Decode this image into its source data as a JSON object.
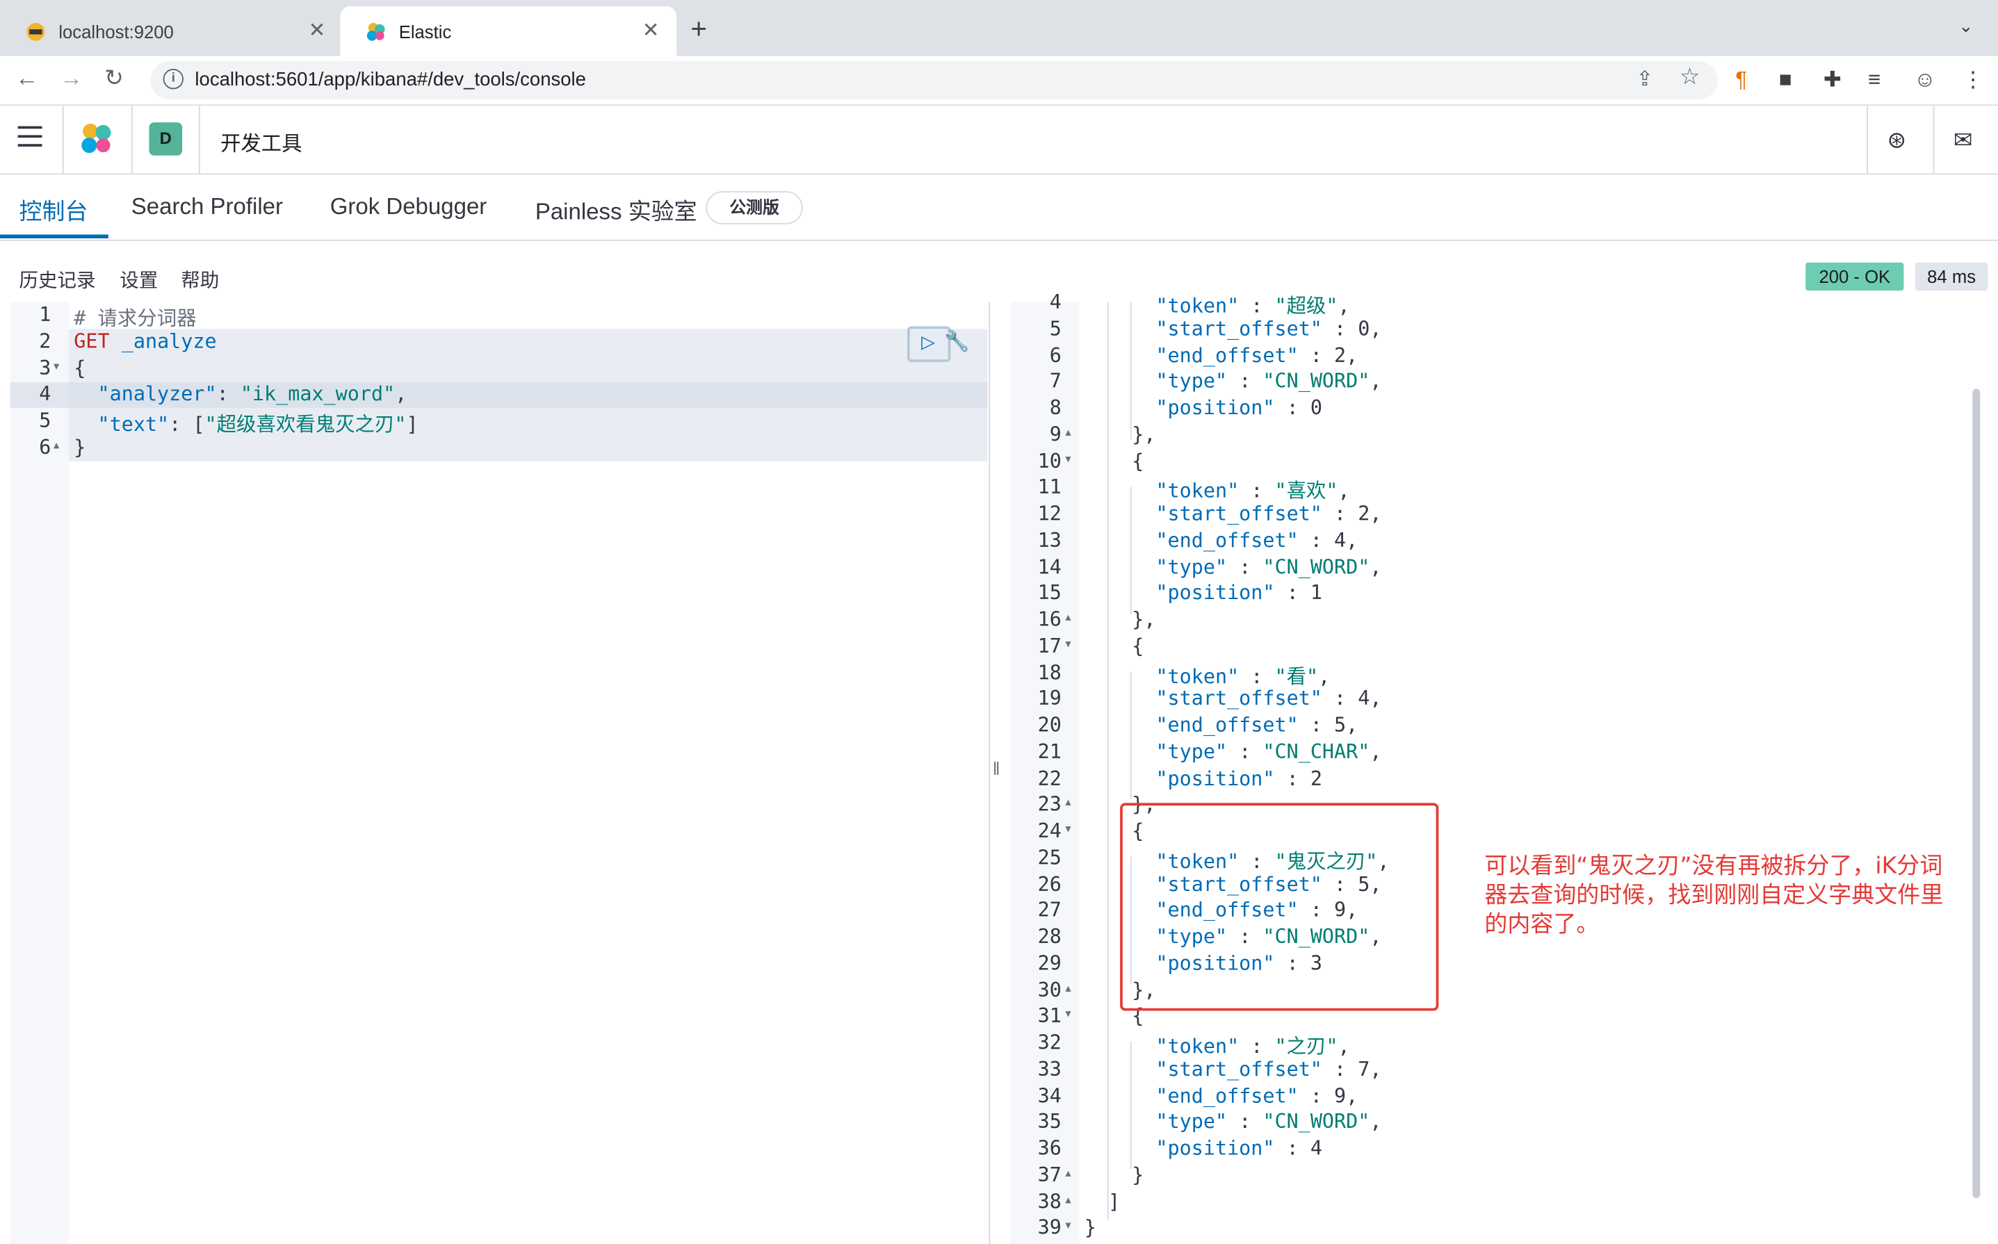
{
  "browser": {
    "tabs": [
      {
        "title": "localhost:9200",
        "close": "✕",
        "icon": "elasticsearch-favicon-icon"
      },
      {
        "title": "Elastic",
        "close": "✕",
        "icon": "elastic-favicon-icon"
      }
    ],
    "new_tab": "+",
    "url": "localhost:5601/app/kibana#/dev_tools/console"
  },
  "kibana": {
    "space_initial": "D",
    "breadcrumb": "开发工具"
  },
  "dev_tabs": [
    {
      "label": "控制台",
      "active": true
    },
    {
      "label": "Search Profiler"
    },
    {
      "label": "Grok Debugger"
    },
    {
      "label": "Painless 实验室"
    }
  ],
  "beta_badge": "公测版",
  "toolbar": {
    "history": "历史记录",
    "settings": "设置",
    "help": "帮助"
  },
  "response": {
    "status": "200 - OK",
    "time": "84 ms"
  },
  "request_lines": [
    "# 请求分词器",
    "GET _analyze",
    "{",
    "  \"analyzer\": \"ik_max_word\",",
    "  \"text\": [\"超级喜欢看鬼灭之刃\"]",
    "}"
  ],
  "response_lines": {
    "first_line_number": 4,
    "lines": [
      "      \"token\" : \"超级\",",
      "      \"start_offset\" : 0,",
      "      \"end_offset\" : 2,",
      "      \"type\" : \"CN_WORD\",",
      "      \"position\" : 0",
      "    },",
      "    {",
      "      \"token\" : \"喜欢\",",
      "      \"start_offset\" : 2,",
      "      \"end_offset\" : 4,",
      "      \"type\" : \"CN_WORD\",",
      "      \"position\" : 1",
      "    },",
      "    {",
      "      \"token\" : \"看\",",
      "      \"start_offset\" : 4,",
      "      \"end_offset\" : 5,",
      "      \"type\" : \"CN_CHAR\",",
      "      \"position\" : 2",
      "    },",
      "    {",
      "      \"token\" : \"鬼灭之刃\",",
      "      \"start_offset\" : 5,",
      "      \"end_offset\" : 9,",
      "      \"type\" : \"CN_WORD\",",
      "      \"position\" : 3",
      "    },",
      "    {",
      "      \"token\" : \"之刃\",",
      "      \"start_offset\" : 7,",
      "      \"end_offset\" : 9,",
      "      \"type\" : \"CN_WORD\",",
      "      \"position\" : 4",
      "    }",
      "  ]",
      "}"
    ]
  },
  "annotation": "可以看到“鬼灭之刃”没有再被拆分了，iK分词器去查询的时候，找到刚刚自定义字典文件里的内容了。"
}
